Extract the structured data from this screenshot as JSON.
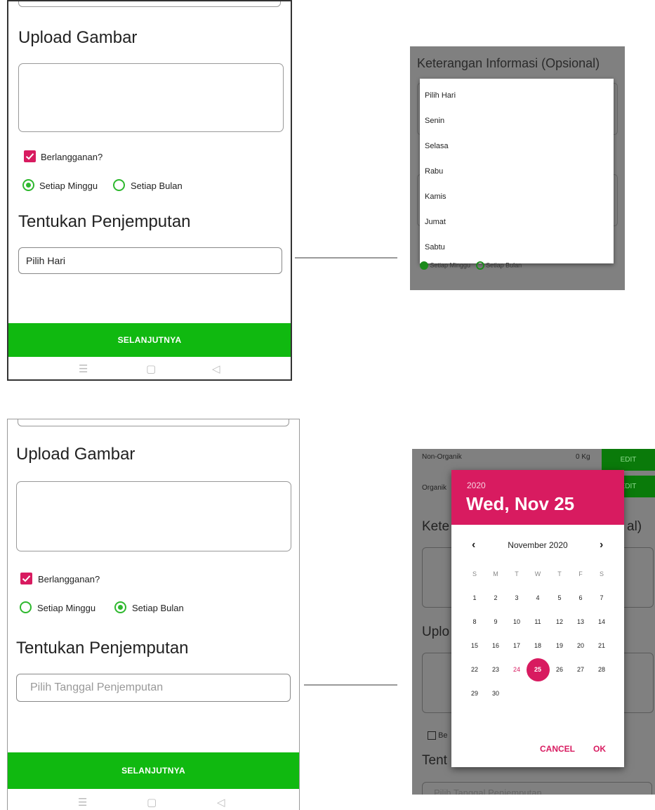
{
  "screen_top": {
    "upload_heading": "Upload Gambar",
    "checkbox_label": "Berlangganan?",
    "radio_weekly_label": "Setiap Minggu",
    "radio_monthly_label": "Setiap Bulan",
    "radio_selected": "weekly",
    "pickup_heading": "Tentukan Penjemputan",
    "pickup_field_value": "Pilih Hari",
    "next_button": "SELANJUTNYA",
    "nav_icons": [
      "menu-icon",
      "home-square-icon",
      "back-triangle-icon"
    ]
  },
  "dropdown_popup": {
    "background_heading": "Keterangan Informasi (Opsional)",
    "background_radio_weekly": "Setiap Minggu",
    "background_radio_monthly": "Setiap Bulan",
    "options": [
      "Pilih Hari",
      "Senin",
      "Selasa",
      "Rabu",
      "Kamis",
      "Jumat",
      "Sabtu"
    ]
  },
  "screen_bottom": {
    "upload_heading": "Upload Gambar",
    "checkbox_label": "Berlangganan?",
    "radio_weekly_label": "Setiap Minggu",
    "radio_monthly_label": "Setiap Bulan",
    "radio_selected": "monthly",
    "pickup_heading": "Tentukan Penjemputan",
    "pickup_field_placeholder": "Pilih Tanggal Penjemputan",
    "next_button": "SELANJUTNYA",
    "nav_icons": [
      "menu-icon",
      "home-square-icon",
      "back-triangle-icon"
    ]
  },
  "date_picker": {
    "background": {
      "row1_label": "Non-Organik",
      "row1_value": "0 Kg",
      "row2_label": "Organik",
      "edit_label": "EDIT",
      "partial_heading_left": "Kete",
      "partial_heading_right": "al)",
      "partial_upload": "Uplo",
      "partial_checkbox": "Be",
      "partial_pickup": "Tent",
      "partial_field": "Pilih Tanggal Penjemputan"
    },
    "year": "2020",
    "selected_date_label": "Wed, Nov 25",
    "month_label": "November 2020",
    "prev_arrow": "‹",
    "next_arrow": "›",
    "weekday_headers": [
      "S",
      "M",
      "T",
      "W",
      "T",
      "F",
      "S"
    ],
    "weeks": [
      [
        "1",
        "2",
        "3",
        "4",
        "5",
        "6",
        "7"
      ],
      [
        "8",
        "9",
        "10",
        "11",
        "12",
        "13",
        "14"
      ],
      [
        "15",
        "16",
        "17",
        "18",
        "19",
        "20",
        "21"
      ],
      [
        "22",
        "23",
        "24",
        "25",
        "26",
        "27",
        "28"
      ],
      [
        "29",
        "30"
      ]
    ],
    "today_day": "24",
    "selected_day": "25",
    "cancel_label": "CANCEL",
    "ok_label": "OK",
    "accent_color": "#d81b60"
  },
  "colors": {
    "green_button": "#10b910",
    "green_radio": "#2eb82e",
    "pink_accent": "#d81b60"
  }
}
